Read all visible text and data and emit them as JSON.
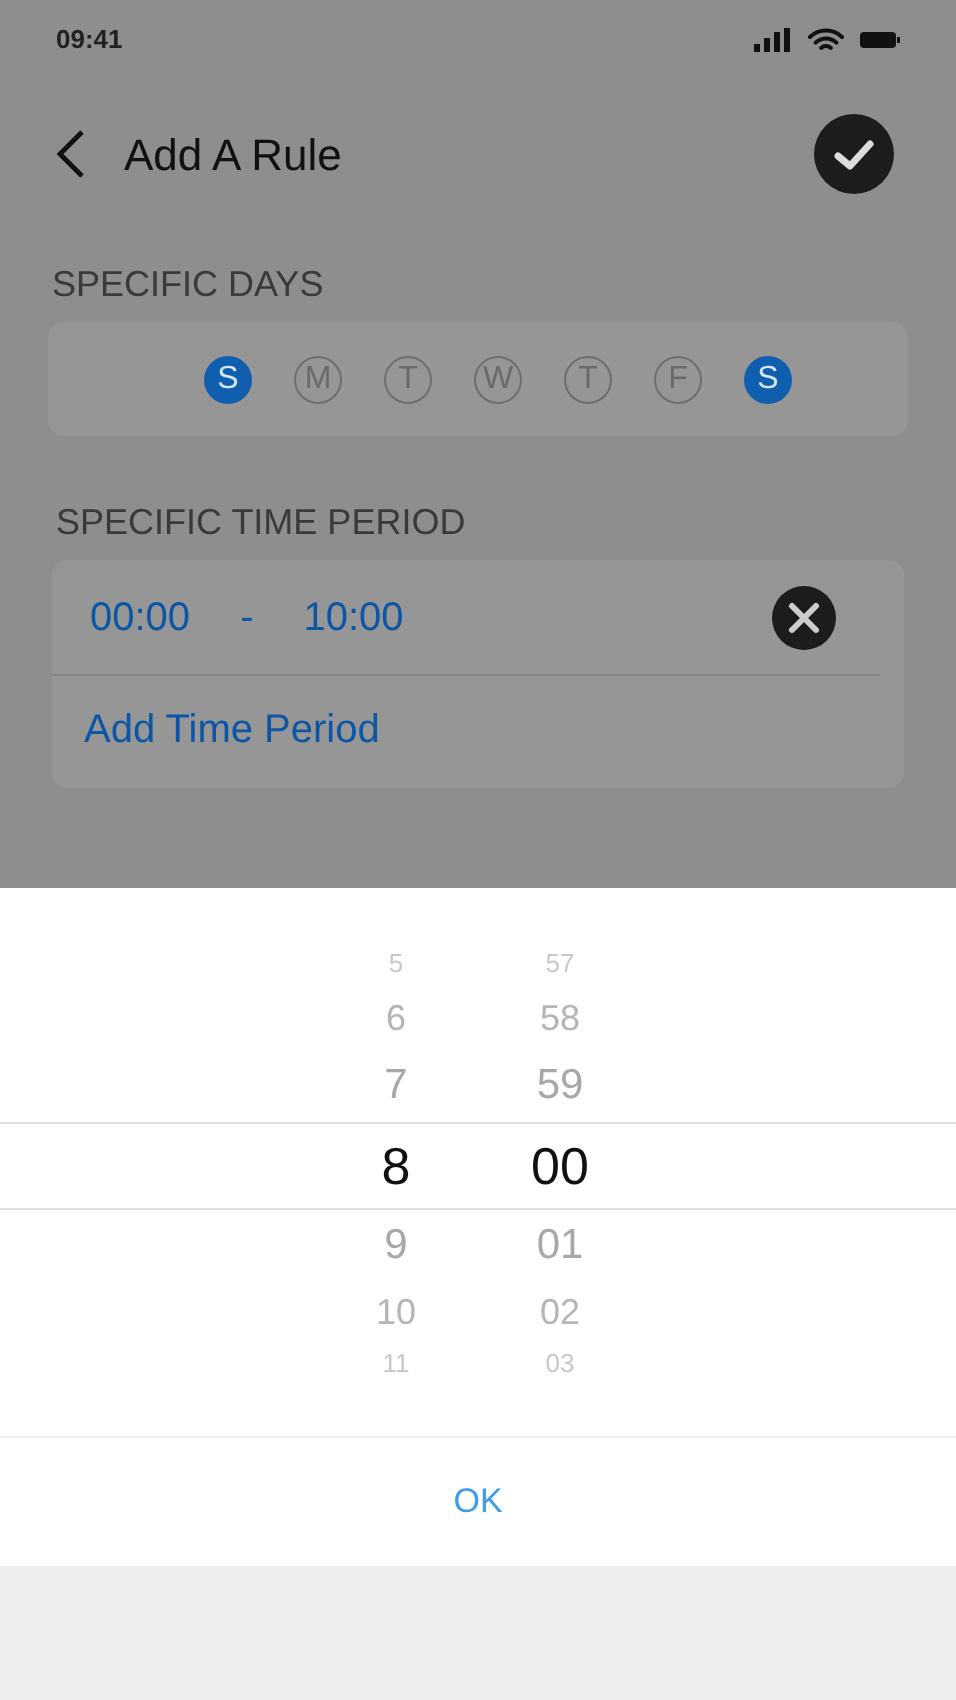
{
  "status_bar": {
    "time": "09:41"
  },
  "header": {
    "title": "Add A Rule"
  },
  "days": {
    "label": "SPECIFIC DAYS",
    "items": [
      {
        "letter": "S",
        "selected": true
      },
      {
        "letter": "M",
        "selected": false
      },
      {
        "letter": "T",
        "selected": false
      },
      {
        "letter": "W",
        "selected": false
      },
      {
        "letter": "T",
        "selected": false
      },
      {
        "letter": "F",
        "selected": false
      },
      {
        "letter": "S",
        "selected": true
      }
    ]
  },
  "time_period": {
    "label": "SPECIFIC TIME PERIOD",
    "start": "00:00",
    "separator": "-",
    "end": "10:00",
    "add_link": "Add Time Period"
  },
  "picker": {
    "hours": [
      {
        "value": "5",
        "selected": false
      },
      {
        "value": "6",
        "selected": false
      },
      {
        "value": "7",
        "selected": false
      },
      {
        "value": "8",
        "selected": true
      },
      {
        "value": "9",
        "selected": false
      },
      {
        "value": "10",
        "selected": false
      },
      {
        "value": "11",
        "selected": false
      }
    ],
    "minutes": [
      {
        "value": "57",
        "selected": false
      },
      {
        "value": "58",
        "selected": false
      },
      {
        "value": "59",
        "selected": false
      },
      {
        "value": "00",
        "selected": true
      },
      {
        "value": "01",
        "selected": false
      },
      {
        "value": "02",
        "selected": false
      },
      {
        "value": "03",
        "selected": false
      }
    ],
    "ok_button": "OK"
  }
}
